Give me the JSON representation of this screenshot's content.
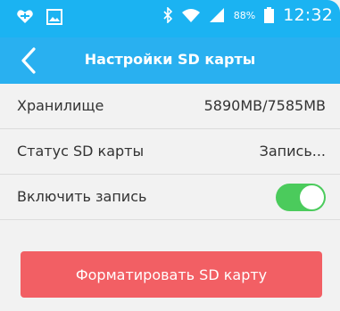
{
  "status_bar": {
    "icons": [
      "heart-notification-icon",
      "image-notification-icon",
      "bluetooth-icon",
      "wifi-icon",
      "signal-icon",
      "battery-icon"
    ],
    "battery": "88%",
    "time": "12:32"
  },
  "header": {
    "title": "Настройки SD карты",
    "back_icon": "chevron-left-icon"
  },
  "settings": {
    "storage": {
      "label": "Хранилище",
      "value": "5890MB/7585MB"
    },
    "sd_status": {
      "label": "Статус SD карты",
      "value": "Запись..."
    },
    "record": {
      "label": "Включить запись",
      "enabled": true
    }
  },
  "format_button": {
    "label": "Форматировать SD карту"
  },
  "colors": {
    "status_bar": "#1bb3f2",
    "app_bar": "#29b0f0",
    "toggle_on": "#4bcb5c",
    "format_button": "#f25f64",
    "background": "#f2f2f2"
  }
}
